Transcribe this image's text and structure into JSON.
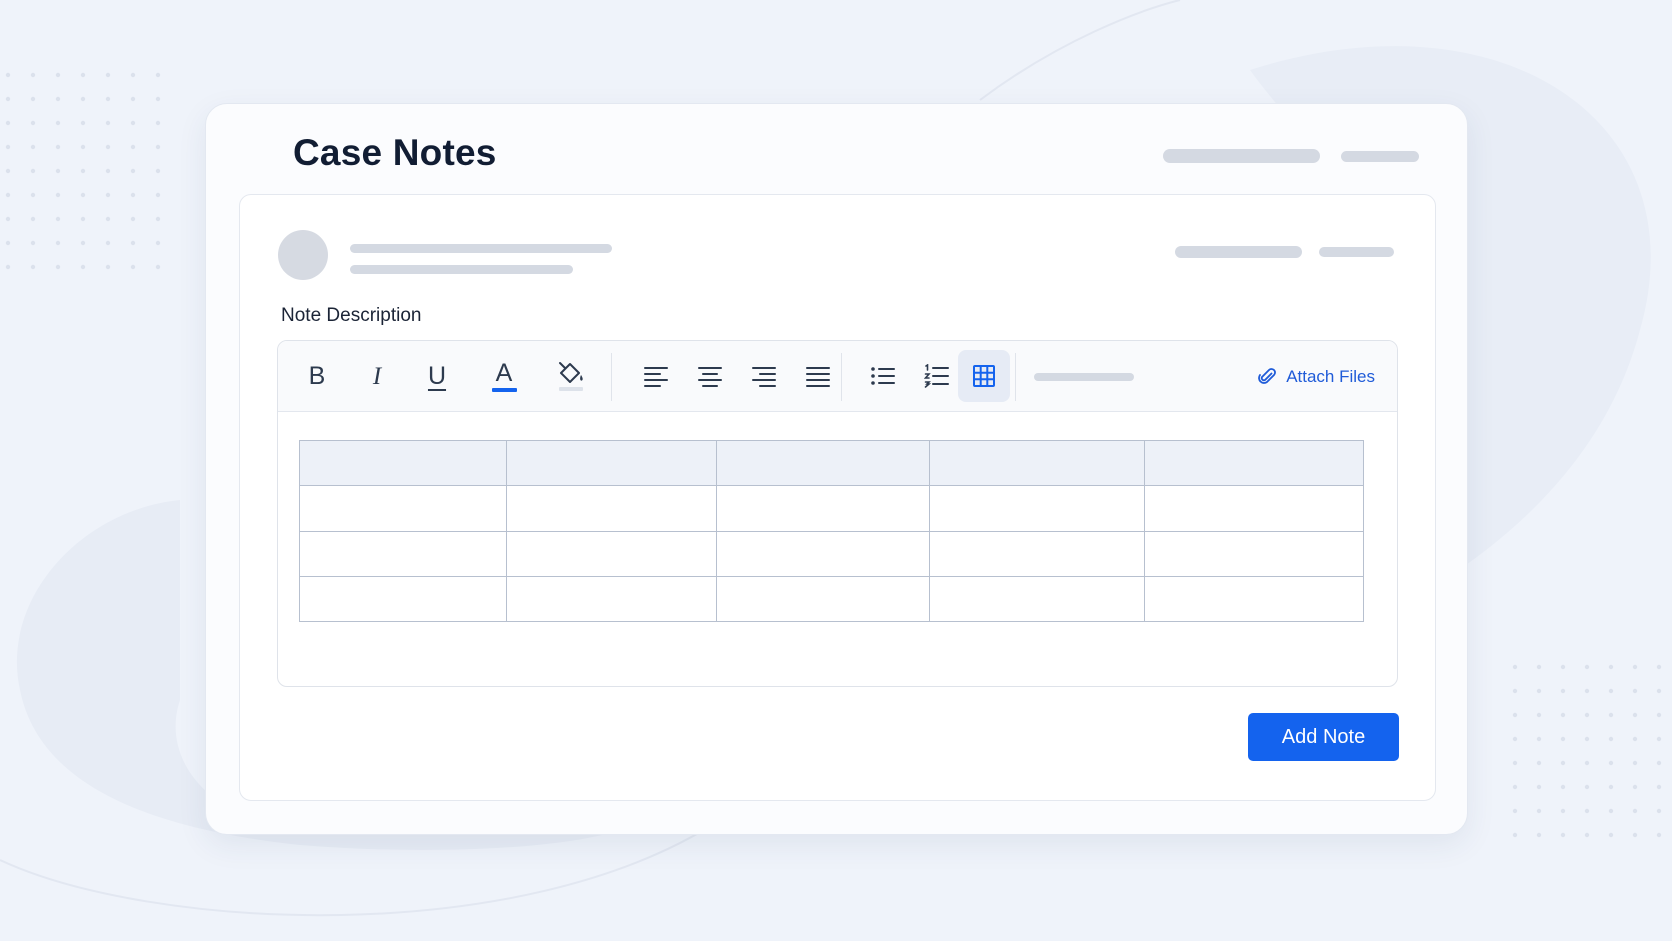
{
  "page": {
    "title": "Case Notes"
  },
  "note_form": {
    "description_label": "Note Description",
    "attach_label": "Attach Files",
    "submit_label": "Add Note"
  },
  "toolbar": {
    "buttons": [
      {
        "name": "bold-button",
        "glyph": "B",
        "icon": "bold-icon"
      },
      {
        "name": "italic-button",
        "glyph": "I",
        "icon": "italic-icon"
      },
      {
        "name": "underline-button",
        "glyph": "U",
        "icon": "underline-icon"
      },
      {
        "name": "text-color-button",
        "glyph": "A",
        "icon": "text-color-icon"
      },
      {
        "name": "highlight-button",
        "icon": "paint-bucket-icon"
      },
      {
        "name": "align-left-button",
        "icon": "align-left-icon"
      },
      {
        "name": "align-center-button",
        "icon": "align-center-icon"
      },
      {
        "name": "align-right-button",
        "icon": "align-right-icon"
      },
      {
        "name": "justify-button",
        "icon": "align-justify-icon"
      },
      {
        "name": "bullet-list-button",
        "icon": "bullet-list-icon"
      },
      {
        "name": "numbered-list-button",
        "icon": "numbered-list-icon"
      },
      {
        "name": "table-button",
        "icon": "table-icon",
        "active": true
      }
    ]
  },
  "table": {
    "columns": 5,
    "rows": 4,
    "header_row": true,
    "cells": [
      [
        "",
        "",
        "",
        "",
        ""
      ],
      [
        "",
        "",
        "",
        "",
        ""
      ],
      [
        "",
        "",
        "",
        "",
        ""
      ],
      [
        "",
        "",
        "",
        "",
        ""
      ]
    ]
  },
  "colors": {
    "accent": "#1463ee",
    "link": "#1f5bd8",
    "text_color_underline": "#1463ee",
    "placeholder": "#d4d9e2",
    "background": "#eff3fa"
  }
}
